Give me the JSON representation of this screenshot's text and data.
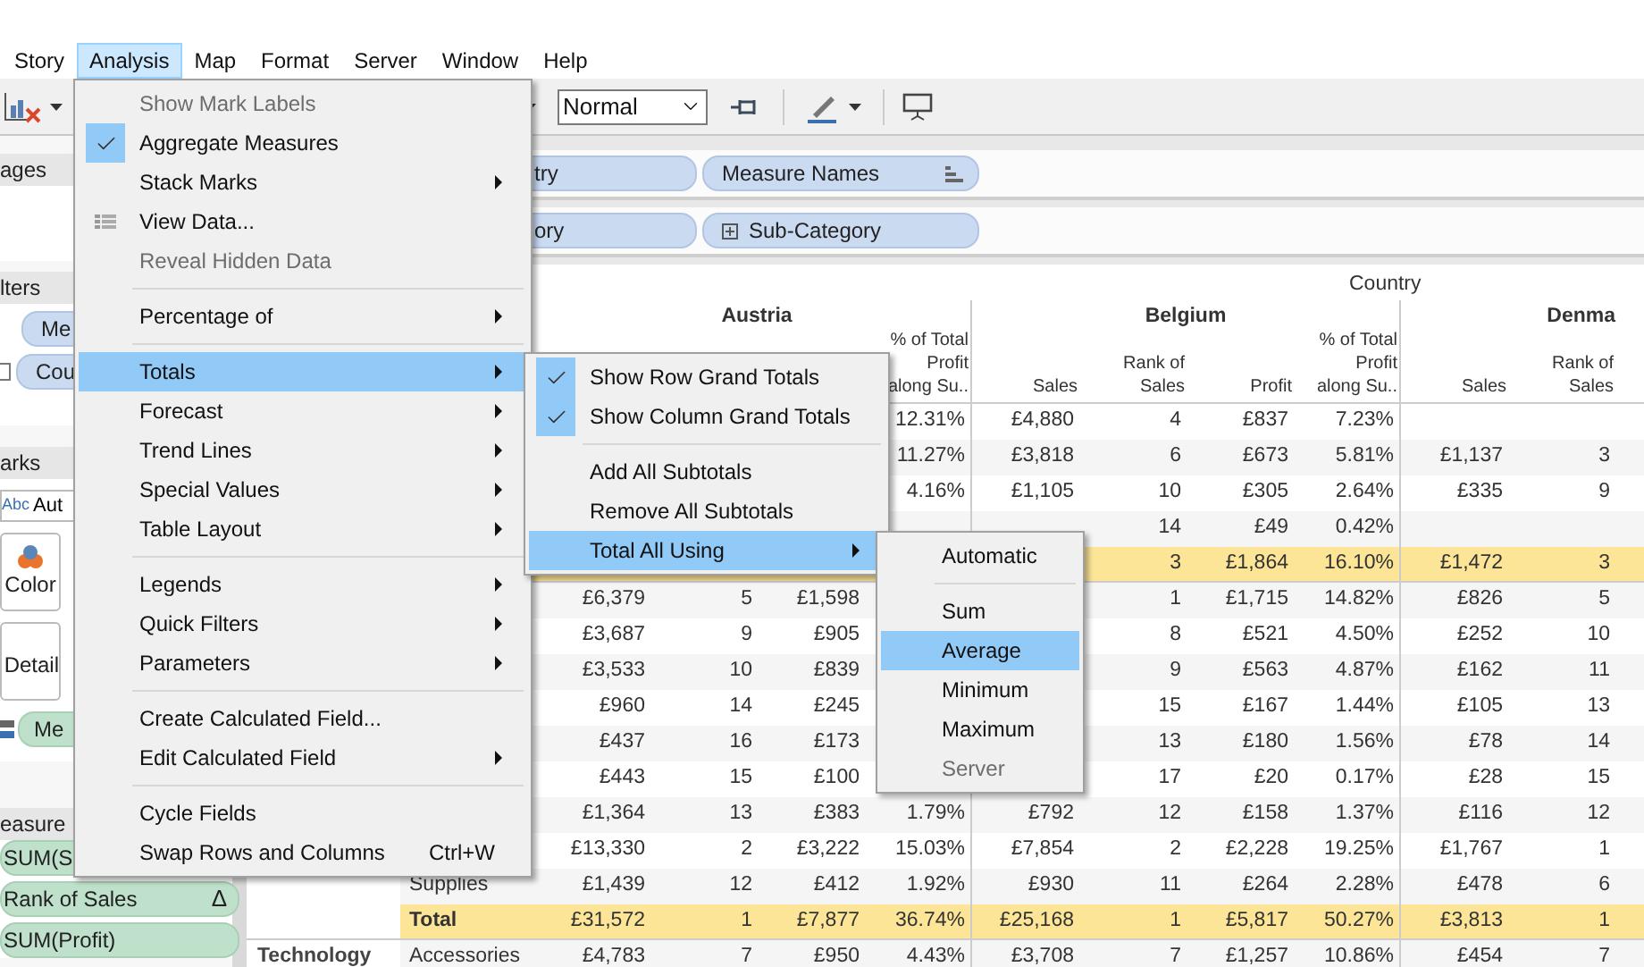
{
  "menu_bar": [
    {
      "label": "Story",
      "selected": false
    },
    {
      "label": "Analysis",
      "selected": true
    },
    {
      "label": "Map",
      "selected": false
    },
    {
      "label": "Format",
      "selected": false
    },
    {
      "label": "Server",
      "selected": false
    },
    {
      "label": "Window",
      "selected": false
    },
    {
      "label": "Help",
      "selected": false
    }
  ],
  "toolbar": {
    "view_size": "Normal"
  },
  "left_panel": {
    "pages_title": "ages",
    "filters_title": "lters",
    "filters": [
      "Me",
      "Cou"
    ],
    "marks_title": "arks",
    "mark_type": {
      "prefix": "Abc",
      "value": "Aut"
    },
    "mark_cards": [
      "Color",
      "Detail"
    ],
    "mark_pill": "Me",
    "measure_values_title": "easure",
    "measure_pills": [
      {
        "label": "SUM(S"
      },
      {
        "label": "Rank of Sales",
        "badge": "Δ"
      },
      {
        "label": "SUM(Profit)"
      }
    ]
  },
  "shelves": {
    "columns": [
      "try",
      "Measure Names"
    ],
    "rows": [
      "ory",
      "Sub-Category"
    ]
  },
  "table": {
    "header": "Country",
    "countries": [
      {
        "name": "Austria",
        "column_headers": [
          "% of Total Profit along Su.."
        ]
      },
      {
        "name": "Belgium",
        "column_headers": [
          "Sales",
          "Rank of Sales",
          "Profit",
          "% of Total Profit along Su.."
        ]
      },
      {
        "name": "Denma",
        "column_headers": [
          "Sales",
          "Rank of Sales"
        ]
      }
    ],
    "rows": [
      {
        "total": false,
        "category": null,
        "sub_category": null,
        "cells": [
          null,
          null,
          null,
          "12.31%",
          "£4,880",
          "4",
          "£837",
          "7.23%",
          null,
          null
        ]
      },
      {
        "total": false,
        "category": null,
        "sub_category": null,
        "cells": [
          null,
          null,
          null,
          "11.27%",
          "£3,818",
          "6",
          "£673",
          "5.81%",
          "£1,137",
          "3"
        ]
      },
      {
        "total": false,
        "category": null,
        "sub_category": null,
        "cells": [
          null,
          null,
          null,
          "4.16%",
          "£1,105",
          "10",
          "£305",
          "2.64%",
          "£335",
          "9"
        ]
      },
      {
        "total": false,
        "category": null,
        "sub_category": null,
        "cells": [
          null,
          null,
          null,
          null,
          null,
          "14",
          "£49",
          "0.42%",
          null,
          null
        ]
      },
      {
        "total": true,
        "category": null,
        "sub_category": null,
        "cells": [
          null,
          null,
          null,
          null,
          null,
          "3",
          "£1,864",
          "16.10%",
          "£1,472",
          "3"
        ]
      },
      {
        "total": false,
        "category": null,
        "sub_category": null,
        "cells": [
          "£6,379",
          "5",
          "£1,598",
          null,
          null,
          "1",
          "£1,715",
          "14.82%",
          "£826",
          "5"
        ]
      },
      {
        "total": false,
        "category": null,
        "sub_category": null,
        "cells": [
          "£3,687",
          "9",
          "£905",
          null,
          null,
          "8",
          "£521",
          "4.50%",
          "£252",
          "10"
        ]
      },
      {
        "total": false,
        "category": null,
        "sub_category": null,
        "cells": [
          "£3,533",
          "10",
          "£839",
          null,
          null,
          "9",
          "£563",
          "4.87%",
          "£162",
          "11"
        ]
      },
      {
        "total": false,
        "category": null,
        "sub_category": null,
        "cells": [
          "£960",
          "14",
          "£245",
          null,
          null,
          "15",
          "£167",
          "1.44%",
          "£105",
          "13"
        ]
      },
      {
        "total": false,
        "category": null,
        "sub_category": null,
        "cells": [
          "£437",
          "16",
          "£173",
          null,
          null,
          "13",
          "£180",
          "1.56%",
          "£78",
          "14"
        ]
      },
      {
        "total": false,
        "category": null,
        "sub_category": null,
        "cells": [
          "£443",
          "15",
          "£100",
          null,
          null,
          "17",
          "£20",
          "0.17%",
          "£28",
          "15"
        ]
      },
      {
        "total": false,
        "category": null,
        "sub_category": null,
        "cells": [
          "£1,364",
          "13",
          "£383",
          "1.79%",
          "£792",
          "12",
          "£158",
          "1.37%",
          "£116",
          "12"
        ]
      },
      {
        "total": false,
        "category": null,
        "sub_category": null,
        "cells": [
          "£13,330",
          "2",
          "£3,222",
          "15.03%",
          "£7,854",
          "2",
          "£2,228",
          "19.25%",
          "£1,767",
          "1"
        ]
      },
      {
        "total": false,
        "category": null,
        "sub_category": "Supplies",
        "cells": [
          "£1,439",
          "12",
          "£412",
          "1.92%",
          "£930",
          "11",
          "£264",
          "2.28%",
          "£478",
          "6"
        ]
      },
      {
        "total": true,
        "category": null,
        "sub_category": "Total",
        "cells": [
          "£31,572",
          "1",
          "£7,877",
          "36.74%",
          "£25,168",
          "1",
          "£5,817",
          "50.27%",
          "£3,813",
          "1"
        ]
      },
      {
        "total": false,
        "category": "Technology",
        "sub_category": "Accessories",
        "cells": [
          "£4,783",
          "7",
          "£950",
          "4.43%",
          "£3,708",
          "7",
          "£1,257",
          "10.86%",
          "£454",
          "7"
        ]
      }
    ]
  },
  "menus": {
    "analysis": [
      {
        "kind": "item",
        "label": "Show Mark Labels",
        "disabled": true,
        "checked": false,
        "selected": false,
        "submenu": false
      },
      {
        "kind": "item",
        "label": "Aggregate Measures",
        "disabled": false,
        "checked": true,
        "selected": false,
        "submenu": false
      },
      {
        "kind": "item",
        "label": "Stack Marks",
        "disabled": false,
        "checked": false,
        "selected": false,
        "submenu": true
      },
      {
        "kind": "icon-item",
        "label": "View Data...",
        "disabled": false,
        "checked": false,
        "selected": false,
        "submenu": false
      },
      {
        "kind": "item",
        "label": "Reveal Hidden Data",
        "disabled": true,
        "checked": false,
        "selected": false,
        "submenu": false
      },
      {
        "kind": "separator"
      },
      {
        "kind": "item",
        "label": "Percentage of",
        "disabled": false,
        "checked": false,
        "selected": false,
        "submenu": true
      },
      {
        "kind": "separator"
      },
      {
        "kind": "item",
        "label": "Totals",
        "disabled": false,
        "checked": false,
        "selected": true,
        "submenu": true
      },
      {
        "kind": "item",
        "label": "Forecast",
        "disabled": false,
        "checked": false,
        "selected": false,
        "submenu": true
      },
      {
        "kind": "item",
        "label": "Trend Lines",
        "disabled": false,
        "checked": false,
        "selected": false,
        "submenu": true
      },
      {
        "kind": "item",
        "label": "Special Values",
        "disabled": false,
        "checked": false,
        "selected": false,
        "submenu": true
      },
      {
        "kind": "item",
        "label": "Table Layout",
        "disabled": false,
        "checked": false,
        "selected": false,
        "submenu": true
      },
      {
        "kind": "separator"
      },
      {
        "kind": "item",
        "label": "Legends",
        "disabled": false,
        "checked": false,
        "selected": false,
        "submenu": true
      },
      {
        "kind": "item",
        "label": "Quick Filters",
        "disabled": false,
        "checked": false,
        "selected": false,
        "submenu": true
      },
      {
        "kind": "item",
        "label": "Parameters",
        "disabled": false,
        "checked": false,
        "selected": false,
        "submenu": true
      },
      {
        "kind": "separator"
      },
      {
        "kind": "item",
        "label": "Create Calculated Field...",
        "disabled": false,
        "checked": false,
        "selected": false,
        "submenu": false
      },
      {
        "kind": "item",
        "label": "Edit Calculated Field",
        "disabled": false,
        "checked": false,
        "selected": false,
        "submenu": true
      },
      {
        "kind": "separator"
      },
      {
        "kind": "item",
        "label": "Cycle Fields",
        "disabled": false,
        "checked": false,
        "selected": false,
        "submenu": false
      },
      {
        "kind": "item",
        "label": "Swap Rows and Columns",
        "shortcut": "Ctrl+W",
        "disabled": false,
        "checked": false,
        "selected": false,
        "submenu": false
      }
    ],
    "totals": [
      {
        "kind": "item",
        "label": "Show Row Grand Totals",
        "disabled": false,
        "checked": true,
        "selected": false,
        "submenu": false
      },
      {
        "kind": "item",
        "label": "Show Column Grand Totals",
        "disabled": false,
        "checked": true,
        "selected": false,
        "submenu": false
      },
      {
        "kind": "separator"
      },
      {
        "kind": "item",
        "label": "Add All Subtotals",
        "disabled": false,
        "checked": false,
        "selected": false,
        "submenu": false
      },
      {
        "kind": "item",
        "label": "Remove All Subtotals",
        "disabled": false,
        "checked": false,
        "selected": false,
        "submenu": false
      },
      {
        "kind": "item",
        "label": "Total All Using",
        "disabled": false,
        "checked": false,
        "selected": true,
        "submenu": true
      }
    ],
    "total_all_using": [
      {
        "kind": "item",
        "label": "Automatic",
        "disabled": false,
        "checked": false,
        "selected": false,
        "submenu": false
      },
      {
        "kind": "separator"
      },
      {
        "kind": "item",
        "label": "Sum",
        "disabled": false,
        "checked": false,
        "selected": false,
        "submenu": false
      },
      {
        "kind": "item",
        "label": "Average",
        "disabled": false,
        "checked": false,
        "selected": true,
        "submenu": false
      },
      {
        "kind": "item",
        "label": "Minimum",
        "disabled": false,
        "checked": false,
        "selected": false,
        "submenu": false
      },
      {
        "kind": "item",
        "label": "Maximum",
        "disabled": false,
        "checked": false,
        "selected": false,
        "submenu": false
      },
      {
        "kind": "item",
        "label": "Server",
        "disabled": true,
        "checked": false,
        "selected": false,
        "submenu": false
      }
    ]
  }
}
